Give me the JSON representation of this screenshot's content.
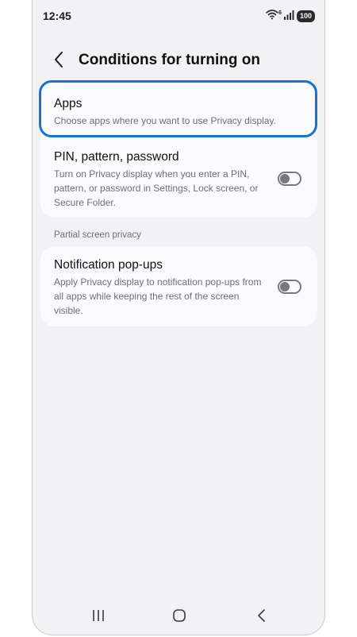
{
  "status_bar": {
    "time": "12:45",
    "icons": [
      "wifi-icon",
      "signal-icon",
      "battery-icon"
    ],
    "wifi_badge": "6",
    "battery": "100"
  },
  "header": {
    "back_icon": "chevron-left-icon",
    "title": "Conditions for turning on"
  },
  "settings": {
    "items": [
      {
        "title": "Apps",
        "description": "Choose apps where you want to use Privacy display.",
        "highlighted": true
      },
      {
        "title": "PIN, pattern, password",
        "description": "Turn on Privacy display when you enter a PIN, pattern, or password in Settings, Lock screen, or Secure Folder.",
        "toggle_on": false
      }
    ]
  },
  "partial_section": {
    "label": "Partial screen privacy",
    "items": [
      {
        "title": "Notification pop-ups",
        "description": "Apply Privacy display to notification pop-ups from all apps while keeping the rest of the screen visible.",
        "toggle_on": false
      }
    ]
  },
  "nav_bar": {
    "buttons": [
      "recents-icon",
      "home-icon",
      "back-icon"
    ]
  },
  "colors": {
    "highlight": "#1673d6",
    "background": "#f2f2f4",
    "card": "#fbfbfd"
  }
}
